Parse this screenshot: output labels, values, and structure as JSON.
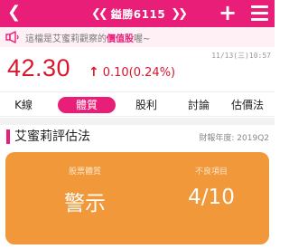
{
  "header": {
    "back_icon": "chevron-left-icon",
    "prev_icon": "double-chevron-left-icon",
    "next_icon": "double-chevron-right-icon",
    "title": "鎰勝6115",
    "add_icon": "plus-icon",
    "menu_icon": "hamburger-menu-icon",
    "color": "#e91e78"
  },
  "notice": {
    "icon": "megaphone-icon",
    "prefix": "這檔是艾蜜莉觀察的",
    "highlight": "價值股",
    "suffix": "喔~"
  },
  "quote": {
    "timestamp": "11/13(三)10:57",
    "price": "42.30",
    "change_arrow": "↑",
    "change": "0.10(0.24%)",
    "up_color": "#d9162c"
  },
  "tabs": [
    {
      "label": "K線",
      "active": false
    },
    {
      "label": "體質",
      "active": true
    },
    {
      "label": "股利",
      "active": false
    },
    {
      "label": "討論",
      "active": false
    },
    {
      "label": "估價法",
      "active": false
    }
  ],
  "section": {
    "title": "艾蜜莉評估法",
    "report_date": "財報年度: 2019Q2"
  },
  "card": {
    "left_label": "股票體質",
    "left_value": "警示",
    "right_label": "不良項目",
    "right_value": "4/10",
    "color": "#f0983a"
  }
}
